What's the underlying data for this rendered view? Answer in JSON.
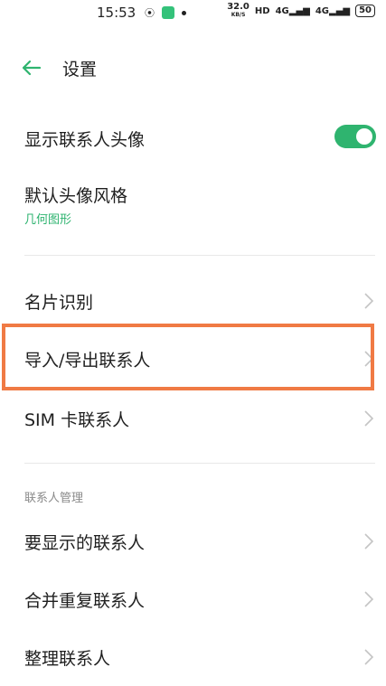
{
  "status_bar": {
    "time": "15:53",
    "speed_value": "32.0",
    "speed_unit": "KB/S",
    "hd": "HD",
    "net1": "4G",
    "net2": "4G",
    "battery": "50"
  },
  "header": {
    "title": "设置"
  },
  "items": {
    "show_avatar": {
      "label": "显示联系人头像",
      "toggle_on": true
    },
    "avatar_style": {
      "label": "默认头像风格",
      "value": "几何图形"
    },
    "business_card": {
      "label": "名片识别"
    },
    "import_export": {
      "label": "导入/导出联系人"
    },
    "sim_contacts": {
      "label": "SIM 卡联系人"
    }
  },
  "section_contacts": {
    "title": "联系人管理",
    "items": {
      "display": {
        "label": "要显示的联系人"
      },
      "merge": {
        "label": "合并重复联系人"
      },
      "organize": {
        "label": "整理联系人"
      }
    }
  },
  "colors": {
    "accent": "#2fb46f",
    "highlight": "#f07a44"
  }
}
